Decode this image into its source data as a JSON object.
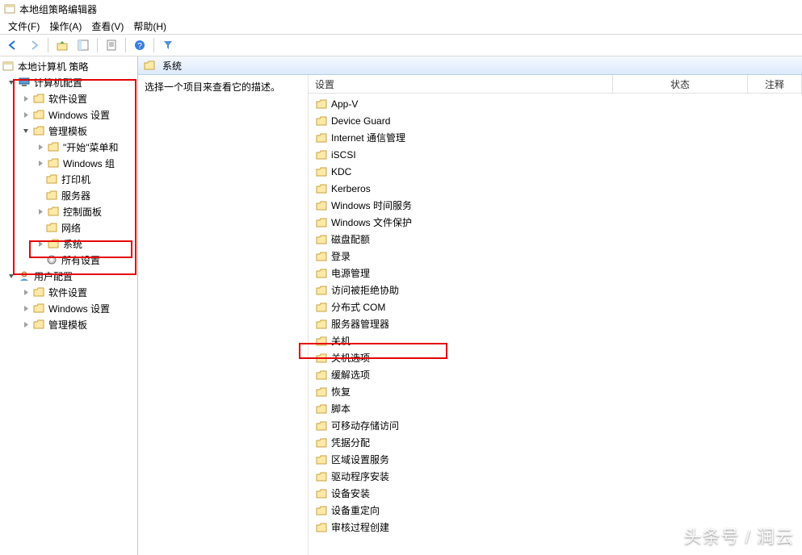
{
  "window": {
    "title": "本地组策略编辑器"
  },
  "menu": {
    "file": "文件(F)",
    "action": "操作(A)",
    "view": "查看(V)",
    "help": "帮助(H)"
  },
  "tree": {
    "root": "本地计算机 策略",
    "computer_config": "计算机配置",
    "software_settings": "软件设置",
    "windows_settings": "Windows 设置",
    "admin_templates": "管理模板",
    "start_menu": "\"开始\"菜单和",
    "windows_components": "Windows 组",
    "printers": "打印机",
    "servers": "服务器",
    "control_panel": "控制面板",
    "network": "网络",
    "system": "系统",
    "all_settings": "所有设置",
    "user_config": "用户配置",
    "u_software": "软件设置",
    "u_windows": "Windows 设置",
    "u_admin": "管理模板"
  },
  "right": {
    "title": "系统",
    "description": "选择一个项目来查看它的描述。",
    "cols": {
      "setting": "设置",
      "state": "状态",
      "note": "注释"
    },
    "items": [
      "App-V",
      "Device Guard",
      "Internet 通信管理",
      "iSCSI",
      "KDC",
      "Kerberos",
      "Windows 时间服务",
      "Windows 文件保护",
      "磁盘配额",
      "登录",
      "电源管理",
      "访问被拒绝协助",
      "分布式 COM",
      "服务器管理器",
      "关机",
      "关机选项",
      "缓解选项",
      "恢复",
      "脚本",
      "可移动存储访问",
      "凭据分配",
      "区域设置服务",
      "驱动程序安装",
      "设备安装",
      "设备重定向",
      "审核过程创建"
    ]
  },
  "watermark": "头条号 / 润云"
}
